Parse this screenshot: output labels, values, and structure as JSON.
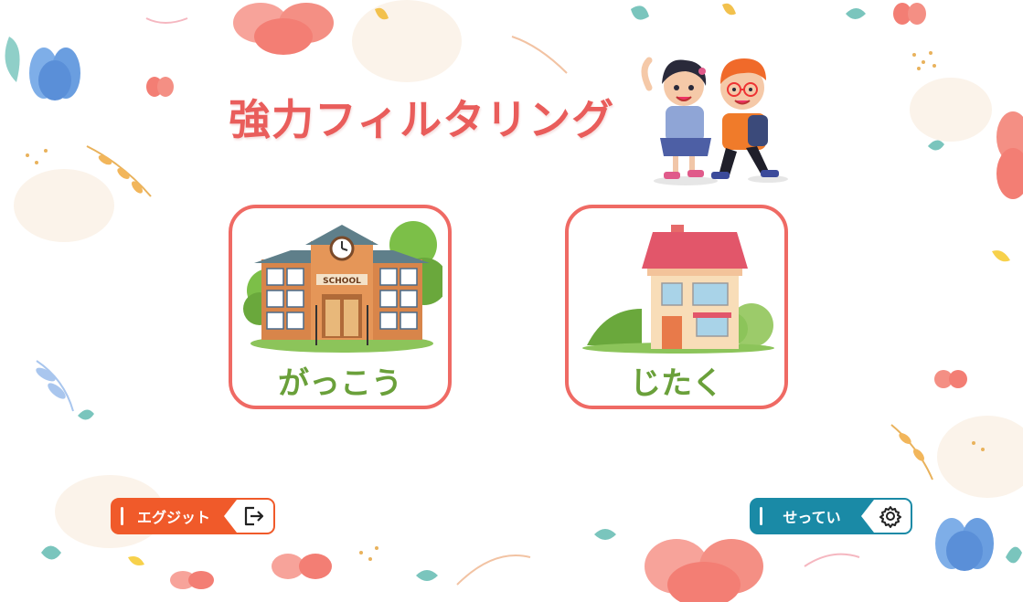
{
  "app": {
    "title": "強力フィルタリング"
  },
  "modes": [
    {
      "label": "がっこう",
      "icon": "school-building",
      "sign": "SCHOOL"
    },
    {
      "label": "じたく",
      "icon": "house"
    }
  ],
  "footer": {
    "exit_label": "エグジット",
    "exit_icon": "logout-icon",
    "settings_label": "せってい",
    "settings_icon": "gear-icon"
  },
  "colors": {
    "title": "#e95d5b",
    "card_border": "#ef6a64",
    "card_label": "#6aa03a",
    "exit_button": "#f05a2a",
    "settings_button": "#1a8aa6"
  }
}
